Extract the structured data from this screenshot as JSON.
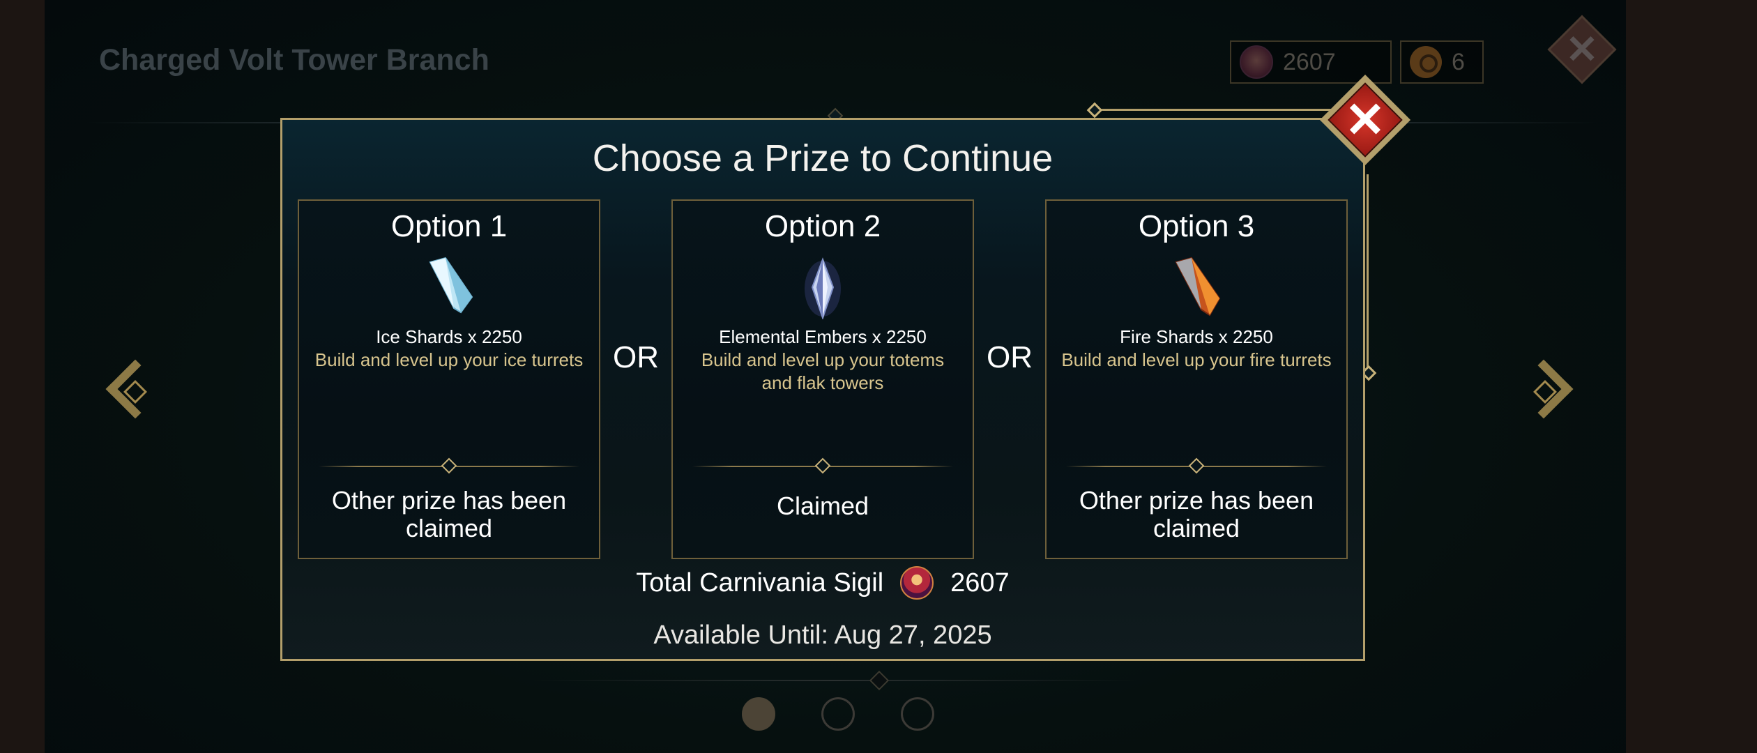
{
  "background": {
    "title": "Charged Volt Tower Branch",
    "sigil_count": "2607",
    "parts_count": "6"
  },
  "modal": {
    "title": "Choose a Prize to Continue",
    "or_label": "OR",
    "options": [
      {
        "title": "Option 1",
        "item": "Ice Shards x 2250",
        "description": "Build and level up your ice turrets",
        "status": "Other prize has been claimed",
        "icon": "ice-shard-icon"
      },
      {
        "title": "Option 2",
        "item": "Elemental Embers x 2250",
        "description": "Build and level up your totems and flak towers",
        "status": "Claimed",
        "icon": "elemental-ember-icon"
      },
      {
        "title": "Option 3",
        "item": "Fire Shards x 2250",
        "description": "Build and level up your fire turrets",
        "status": "Other prize has been claimed",
        "icon": "fire-shard-icon"
      }
    ],
    "total_label": "Total Carnivania Sigil",
    "total_value": "2607",
    "available_until": "Available Until: Aug 27, 2025"
  },
  "pagination": {
    "pages": 3,
    "active": 1
  },
  "colors": {
    "gold": "#b39f6b",
    "desc_text": "#d8c58e",
    "close_red": "#d6362a"
  }
}
